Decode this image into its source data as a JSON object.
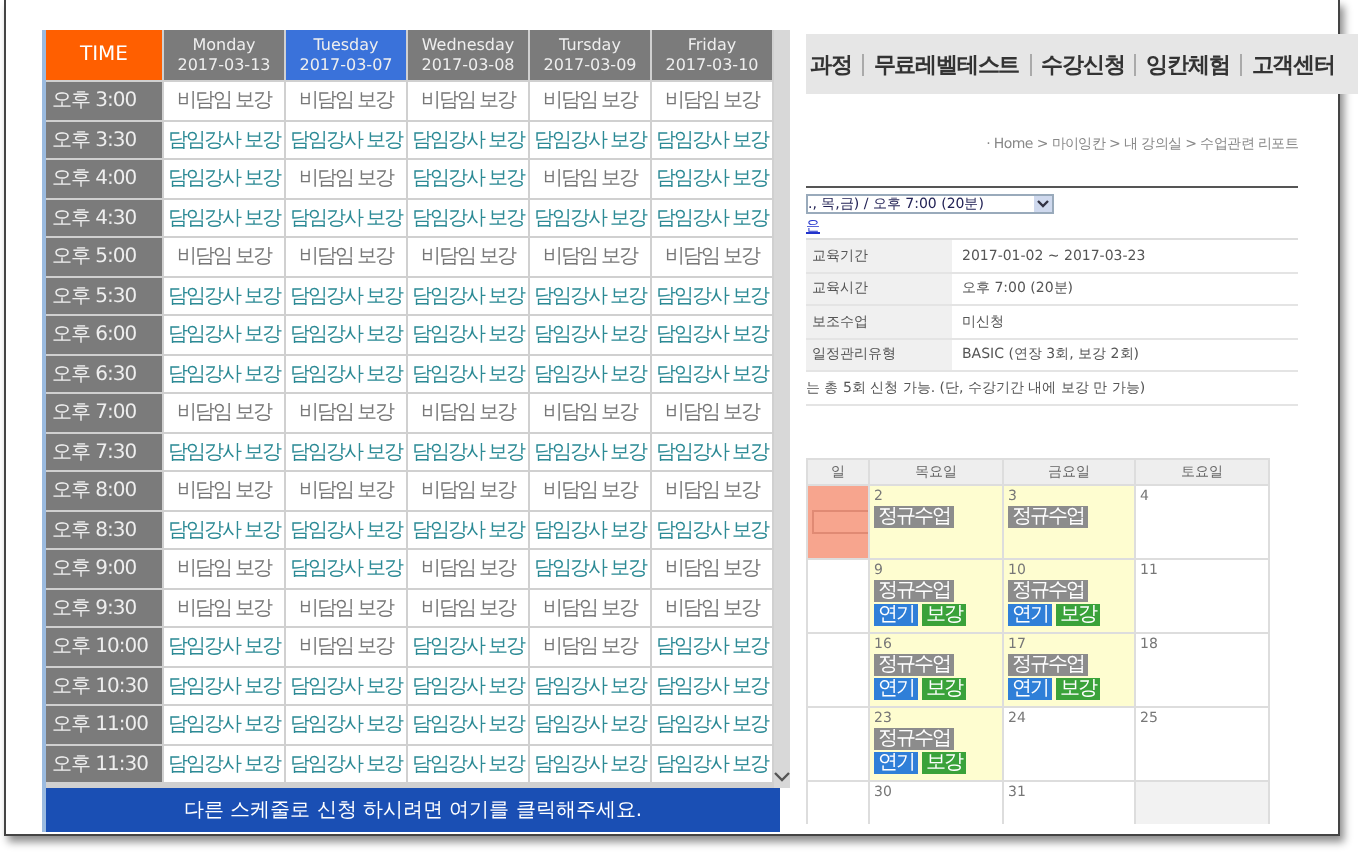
{
  "popup": {
    "time_header": "TIME",
    "days": [
      {
        "name": "Monday",
        "date": "2017-03-13",
        "selected": false
      },
      {
        "name": "Tuesday",
        "date": "2017-03-07",
        "selected": true
      },
      {
        "name": "Wednesday",
        "date": "2017-03-08",
        "selected": false
      },
      {
        "name": "Tursday",
        "date": "2017-03-09",
        "selected": false
      },
      {
        "name": "Friday",
        "date": "2017-03-10",
        "selected": false
      }
    ],
    "rows": [
      {
        "time": "오후 3:00",
        "cells": [
          {
            "text": "비담임 보강",
            "kind": "other"
          },
          {
            "text": "비담임 보강",
            "kind": "other"
          },
          {
            "text": "비담임 보강",
            "kind": "other"
          },
          {
            "text": "비담임 보강",
            "kind": "other"
          },
          {
            "text": "비담임 보강",
            "kind": "other"
          }
        ]
      },
      {
        "time": "오후 3:30",
        "cells": [
          {
            "text": "담임강사 보강",
            "kind": "homeroom"
          },
          {
            "text": "담임강사 보강",
            "kind": "homeroom"
          },
          {
            "text": "담임강사 보강",
            "kind": "homeroom"
          },
          {
            "text": "담임강사 보강",
            "kind": "homeroom"
          },
          {
            "text": "담임강사 보강",
            "kind": "homeroom"
          }
        ]
      },
      {
        "time": "오후 4:00",
        "cells": [
          {
            "text": "담임강사 보강",
            "kind": "homeroom"
          },
          {
            "text": "비담임 보강",
            "kind": "other"
          },
          {
            "text": "담임강사 보강",
            "kind": "homeroom"
          },
          {
            "text": "비담임 보강",
            "kind": "other"
          },
          {
            "text": "담임강사 보강",
            "kind": "homeroom"
          }
        ]
      },
      {
        "time": "오후 4:30",
        "cells": [
          {
            "text": "담임강사 보강",
            "kind": "homeroom"
          },
          {
            "text": "담임강사 보강",
            "kind": "homeroom"
          },
          {
            "text": "담임강사 보강",
            "kind": "homeroom"
          },
          {
            "text": "담임강사 보강",
            "kind": "homeroom"
          },
          {
            "text": "담임강사 보강",
            "kind": "homeroom"
          }
        ]
      },
      {
        "time": "오후 5:00",
        "cells": [
          {
            "text": "비담임 보강",
            "kind": "other"
          },
          {
            "text": "비담임 보강",
            "kind": "other"
          },
          {
            "text": "비담임 보강",
            "kind": "other"
          },
          {
            "text": "비담임 보강",
            "kind": "other"
          },
          {
            "text": "비담임 보강",
            "kind": "other"
          }
        ]
      },
      {
        "time": "오후 5:30",
        "cells": [
          {
            "text": "담임강사 보강",
            "kind": "homeroom"
          },
          {
            "text": "담임강사 보강",
            "kind": "homeroom"
          },
          {
            "text": "담임강사 보강",
            "kind": "homeroom"
          },
          {
            "text": "담임강사 보강",
            "kind": "homeroom"
          },
          {
            "text": "담임강사 보강",
            "kind": "homeroom"
          }
        ]
      },
      {
        "time": "오후 6:00",
        "cells": [
          {
            "text": "담임강사 보강",
            "kind": "homeroom"
          },
          {
            "text": "담임강사 보강",
            "kind": "homeroom"
          },
          {
            "text": "담임강사 보강",
            "kind": "homeroom"
          },
          {
            "text": "담임강사 보강",
            "kind": "homeroom"
          },
          {
            "text": "담임강사 보강",
            "kind": "homeroom"
          }
        ]
      },
      {
        "time": "오후 6:30",
        "cells": [
          {
            "text": "담임강사 보강",
            "kind": "homeroom"
          },
          {
            "text": "담임강사 보강",
            "kind": "homeroom"
          },
          {
            "text": "담임강사 보강",
            "kind": "homeroom"
          },
          {
            "text": "담임강사 보강",
            "kind": "homeroom"
          },
          {
            "text": "담임강사 보강",
            "kind": "homeroom"
          }
        ]
      },
      {
        "time": "오후 7:00",
        "cells": [
          {
            "text": "비담임 보강",
            "kind": "other"
          },
          {
            "text": "비담임 보강",
            "kind": "other"
          },
          {
            "text": "비담임 보강",
            "kind": "other"
          },
          {
            "text": "비담임 보강",
            "kind": "other"
          },
          {
            "text": "비담임 보강",
            "kind": "other"
          }
        ]
      },
      {
        "time": "오후 7:30",
        "cells": [
          {
            "text": "담임강사 보강",
            "kind": "homeroom"
          },
          {
            "text": "담임강사 보강",
            "kind": "homeroom"
          },
          {
            "text": "담임강사 보강",
            "kind": "homeroom"
          },
          {
            "text": "담임강사 보강",
            "kind": "homeroom"
          },
          {
            "text": "담임강사 보강",
            "kind": "homeroom"
          }
        ]
      },
      {
        "time": "오후 8:00",
        "cells": [
          {
            "text": "비담임 보강",
            "kind": "other"
          },
          {
            "text": "비담임 보강",
            "kind": "other"
          },
          {
            "text": "비담임 보강",
            "kind": "other"
          },
          {
            "text": "비담임 보강",
            "kind": "other"
          },
          {
            "text": "비담임 보강",
            "kind": "other"
          }
        ]
      },
      {
        "time": "오후 8:30",
        "cells": [
          {
            "text": "담임강사 보강",
            "kind": "homeroom"
          },
          {
            "text": "담임강사 보강",
            "kind": "homeroom"
          },
          {
            "text": "담임강사 보강",
            "kind": "homeroom"
          },
          {
            "text": "담임강사 보강",
            "kind": "homeroom"
          },
          {
            "text": "담임강사 보강",
            "kind": "homeroom"
          }
        ]
      },
      {
        "time": "오후 9:00",
        "cells": [
          {
            "text": "비담임 보강",
            "kind": "other"
          },
          {
            "text": "담임강사 보강",
            "kind": "homeroom"
          },
          {
            "text": "비담임 보강",
            "kind": "other"
          },
          {
            "text": "담임강사 보강",
            "kind": "homeroom"
          },
          {
            "text": "비담임 보강",
            "kind": "other"
          }
        ]
      },
      {
        "time": "오후 9:30",
        "cells": [
          {
            "text": "비담임 보강",
            "kind": "other"
          },
          {
            "text": "비담임 보강",
            "kind": "other"
          },
          {
            "text": "비담임 보강",
            "kind": "other"
          },
          {
            "text": "비담임 보강",
            "kind": "other"
          },
          {
            "text": "비담임 보강",
            "kind": "other"
          }
        ]
      },
      {
        "time": "오후 10:00",
        "cells": [
          {
            "text": "담임강사 보강",
            "kind": "homeroom"
          },
          {
            "text": "비담임 보강",
            "kind": "other"
          },
          {
            "text": "담임강사 보강",
            "kind": "homeroom"
          },
          {
            "text": "비담임 보강",
            "kind": "other"
          },
          {
            "text": "담임강사 보강",
            "kind": "homeroom"
          }
        ]
      },
      {
        "time": "오후 10:30",
        "cells": [
          {
            "text": "담임강사 보강",
            "kind": "homeroom"
          },
          {
            "text": "담임강사 보강",
            "kind": "homeroom"
          },
          {
            "text": "담임강사 보강",
            "kind": "homeroom"
          },
          {
            "text": "담임강사 보강",
            "kind": "homeroom"
          },
          {
            "text": "담임강사 보강",
            "kind": "homeroom"
          }
        ]
      },
      {
        "time": "오후 11:00",
        "cells": [
          {
            "text": "담임강사 보강",
            "kind": "homeroom"
          },
          {
            "text": "담임강사 보강",
            "kind": "homeroom"
          },
          {
            "text": "담임강사 보강",
            "kind": "homeroom"
          },
          {
            "text": "담임강사 보강",
            "kind": "homeroom"
          },
          {
            "text": "담임강사 보강",
            "kind": "homeroom"
          }
        ]
      },
      {
        "time": "오후 11:30",
        "cells": [
          {
            "text": "담임강사 보강",
            "kind": "homeroom"
          },
          {
            "text": "담임강사 보강",
            "kind": "homeroom"
          },
          {
            "text": "담임강사 보강",
            "kind": "homeroom"
          },
          {
            "text": "담임강사 보강",
            "kind": "homeroom"
          },
          {
            "text": "담임강사 보강",
            "kind": "homeroom"
          }
        ]
      }
    ],
    "footer": "다른 스케줄로 신청 하시려면 여기를 클릭해주세요."
  },
  "page": {
    "nav": [
      "과정",
      "무료레벨테스트",
      "수강신청",
      "잉칸체험",
      "고객센터"
    ],
    "breadcrumb": "· Home > 마이잉칸 > 내 강의실 > 수업관련 리포트",
    "schedule_select": "., 목,금) / 오후 7:00 (20분)",
    "link": "은",
    "info": [
      {
        "label": "교육기간",
        "value": "2017-01-02 ~ 2017-03-23"
      },
      {
        "label": "교육시간",
        "value": "오후 7:00 (20분)"
      },
      {
        "label": "보조수업",
        "value": "미신청"
      },
      {
        "label": "일정관리유형",
        "value": "BASIC (연장 3회, 보강 2회)"
      }
    ],
    "note": "는 총 5회 신청 가능. (단, 수강기간 내에 보강 만 가능)",
    "calendar": {
      "columns": [
        "일",
        "목요일",
        "금요일",
        "토요일"
      ],
      "weeks": [
        [
          {
            "kind": "booked"
          },
          {
            "day": "2",
            "kind": "class",
            "badges": [
              {
                "text": "정규수업",
                "kind": "regular"
              }
            ]
          },
          {
            "day": "3",
            "kind": "class",
            "badges": [
              {
                "text": "정규수업",
                "kind": "regular"
              }
            ]
          },
          {
            "day": "4",
            "kind": "plain"
          }
        ],
        [
          {
            "kind": "plain"
          },
          {
            "day": "9",
            "kind": "class",
            "badges": [
              {
                "text": "정규수업",
                "kind": "regular"
              },
              {
                "text": "연기",
                "kind": "postpone"
              },
              {
                "text": "보강",
                "kind": "makeup"
              }
            ]
          },
          {
            "day": "10",
            "kind": "class",
            "badges": [
              {
                "text": "정규수업",
                "kind": "regular"
              },
              {
                "text": "연기",
                "kind": "postpone"
              },
              {
                "text": "보강",
                "kind": "makeup"
              }
            ]
          },
          {
            "day": "11",
            "kind": "plain"
          }
        ],
        [
          {
            "kind": "plain"
          },
          {
            "day": "16",
            "kind": "class",
            "badges": [
              {
                "text": "정규수업",
                "kind": "regular"
              },
              {
                "text": "연기",
                "kind": "postpone"
              },
              {
                "text": "보강",
                "kind": "makeup"
              }
            ]
          },
          {
            "day": "17",
            "kind": "class",
            "badges": [
              {
                "text": "정규수업",
                "kind": "regular"
              },
              {
                "text": "연기",
                "kind": "postpone"
              },
              {
                "text": "보강",
                "kind": "makeup"
              }
            ]
          },
          {
            "day": "18",
            "kind": "plain"
          }
        ],
        [
          {
            "kind": "plain"
          },
          {
            "day": "23",
            "kind": "class",
            "badges": [
              {
                "text": "정규수업",
                "kind": "regular"
              },
              {
                "text": "연기",
                "kind": "postpone"
              },
              {
                "text": "보강",
                "kind": "makeup"
              }
            ]
          },
          {
            "day": "24",
            "kind": "plain"
          },
          {
            "day": "25",
            "kind": "plain"
          }
        ],
        [
          {
            "kind": "plain"
          },
          {
            "day": "30",
            "kind": "plain"
          },
          {
            "day": "31",
            "kind": "plain"
          },
          {
            "kind": "empty"
          }
        ]
      ]
    }
  }
}
